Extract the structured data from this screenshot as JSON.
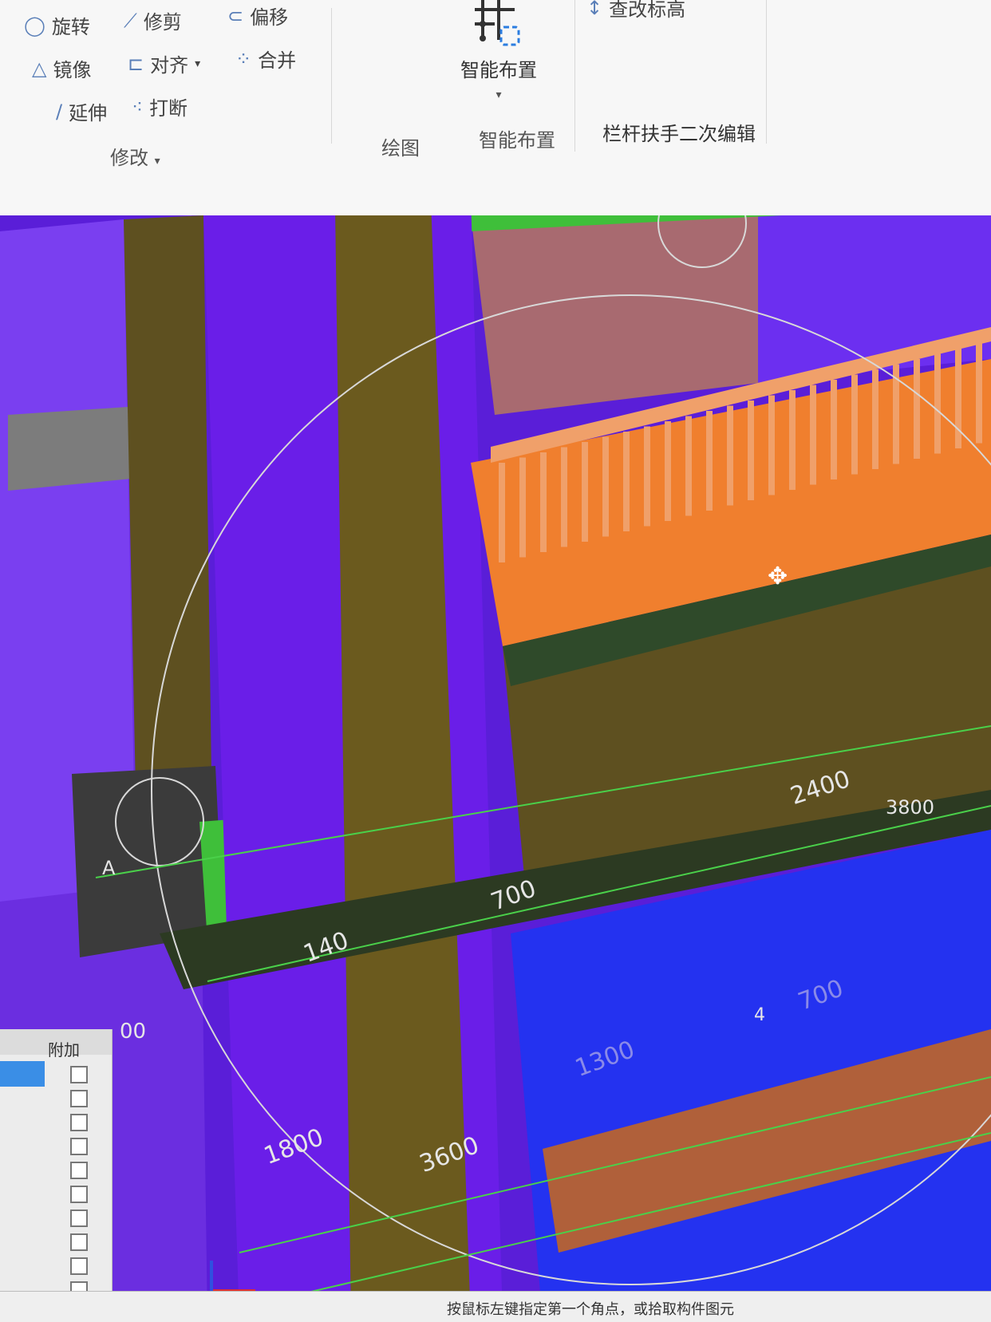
{
  "ribbon": {
    "modify_tools": [
      {
        "label": "旋转",
        "icon": "rotate-icon"
      },
      {
        "label": "修剪",
        "icon": "trim-icon"
      },
      {
        "label": "偏移",
        "icon": "offset-icon"
      },
      {
        "label": "镜像",
        "icon": "mirror-icon"
      },
      {
        "label": "对齐",
        "icon": "align-icon"
      },
      {
        "label": "合并",
        "icon": "merge-icon"
      },
      {
        "label": "延伸",
        "icon": "extend-icon"
      },
      {
        "label": "打断",
        "icon": "break-icon"
      }
    ],
    "modify_group": "修改",
    "draw_group": "绘图",
    "smart_button": "智能布置",
    "smart_group": "智能布置",
    "edit_elevation": "查改标高",
    "railing_group": "栏杆扶手二次编辑"
  },
  "panel": {
    "col_header": "附加",
    "checkbox_count": 10
  },
  "dimensions": [
    "2400",
    "3800",
    "700",
    "140",
    "1800",
    "3600",
    "1300",
    "700",
    "4",
    "A",
    "00"
  ],
  "status_text": "按鼠标左键指定第一个角点，或拾取构件图元",
  "colors": {
    "purple": "#6a1ee8",
    "olive": "#6b5a1e",
    "orange": "#f07f2e",
    "green": "#3aa832",
    "blue": "#2432f0"
  }
}
